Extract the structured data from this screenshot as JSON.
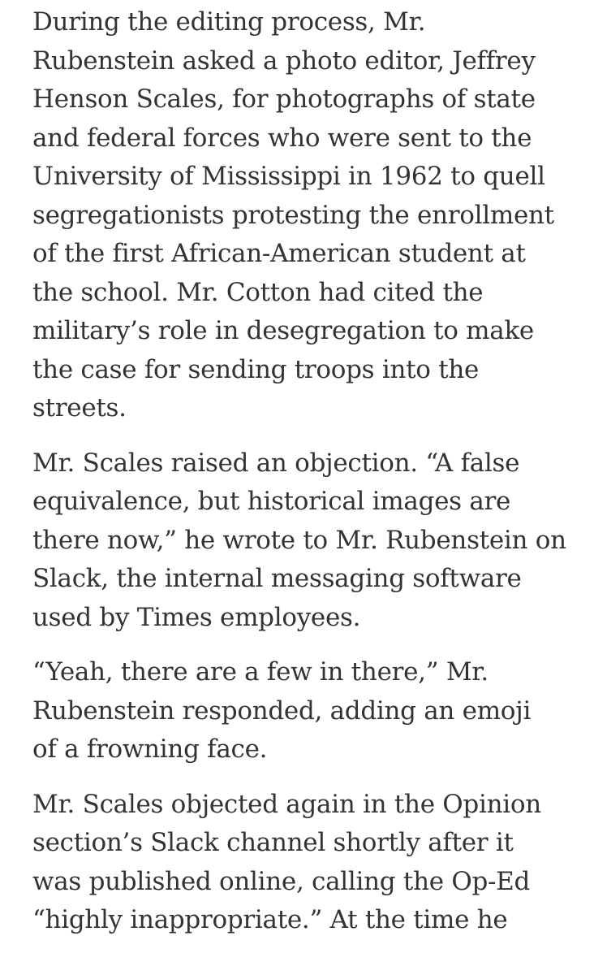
{
  "article": {
    "paragraphs": [
      {
        "lines": [
          "During the editing process, Mr.",
          "Rubenstein asked a photo editor, Jeffrey",
          "Henson Scales, for photographs of state",
          "and federal forces who were sent to the",
          "University of Mississippi in 1962 to quell",
          "segregationists protesting the enrollment",
          "of the first African-American student at",
          "the school. Mr. Cotton had cited the",
          "military’s role in desegregation to make",
          "the case for sending troops into the",
          "streets."
        ]
      },
      {
        "lines": [
          "Mr. Scales raised an objection. “A false",
          "equivalence, but historical images are",
          "there now,” he wrote to Mr. Rubenstein on",
          "Slack, the internal messaging software",
          "used by Times employees."
        ]
      },
      {
        "lines": [
          "“Yeah, there are a few in there,” Mr.",
          "Rubenstein responded, adding an emoji",
          "of a frowning face."
        ]
      },
      {
        "lines": [
          "Mr. Scales objected again in the Opinion",
          "section’s Slack channel shortly after it",
          "was published online, calling the Op-Ed",
          "“highly inappropriate.” At the time he"
        ]
      }
    ]
  }
}
